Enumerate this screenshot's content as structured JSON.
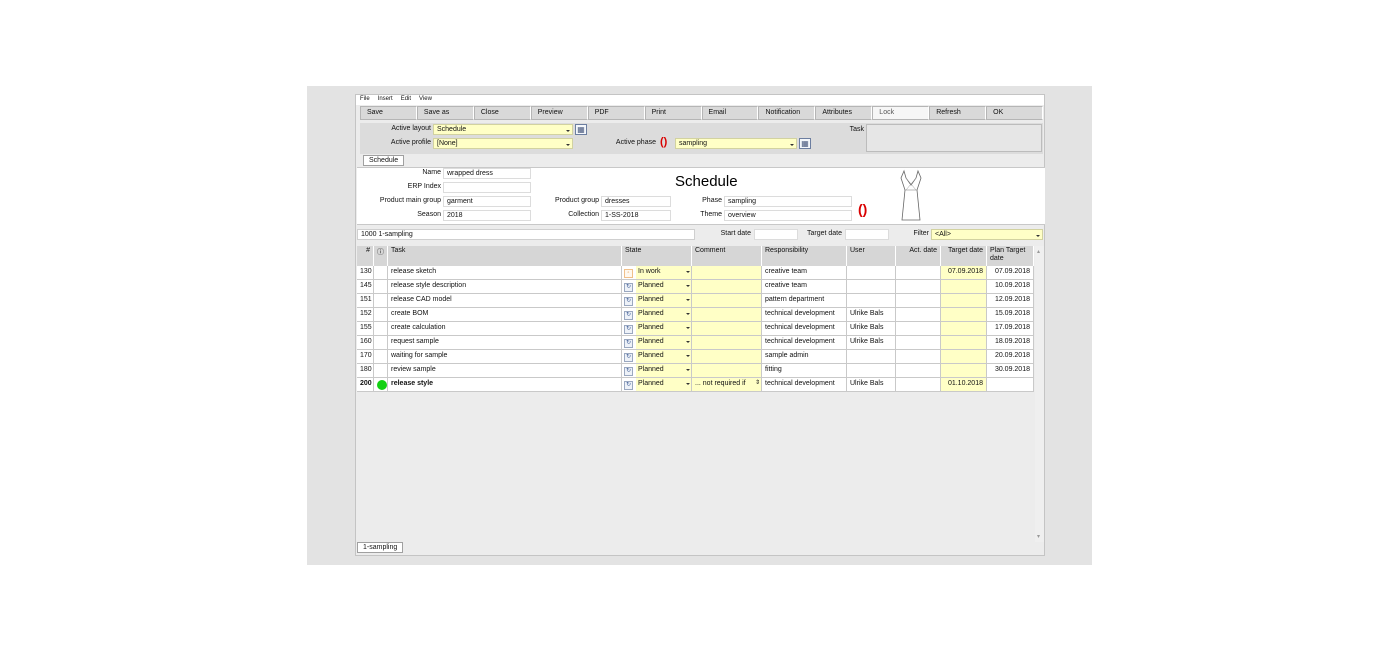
{
  "menu": [
    "File",
    "Insert",
    "Edit",
    "View"
  ],
  "toolbar": {
    "save": "Save",
    "save_as": "Save as",
    "close": "Close",
    "preview": "Preview",
    "pdf": "PDF",
    "print": "Print",
    "email": "Email",
    "notification": "Notification",
    "attributes": "Attributes",
    "lock": "Lock",
    "refresh": "Refresh",
    "ok": "OK"
  },
  "top": {
    "active_layout_label": "Active layout",
    "active_layout_value": "Schedule",
    "active_profile_label": "Active profile",
    "active_profile_value": "[None]",
    "active_phase_label": "Active phase",
    "active_phase_value": "sampling",
    "task_label": "Task"
  },
  "tab": "Schedule",
  "header": {
    "name_label": "Name",
    "name_value": "wrapped dress",
    "erp_label": "ERP Index",
    "erp_value": "",
    "pmg_label": "Product main group",
    "pmg_value": "garment",
    "season_label": "Season",
    "season_value": "2018",
    "pg_label": "Product group",
    "pg_value": "dresses",
    "collection_label": "Collection",
    "collection_value": "1-SS-2018",
    "title": "Schedule",
    "phase_label": "Phase",
    "phase_value": "sampling",
    "theme_label": "Theme",
    "theme_value": "overview"
  },
  "filterbar": {
    "phase_value": "1000 1-sampling",
    "start_label": "Start date",
    "target_label": "Target date",
    "filter_label": "Filter",
    "filter_value": "<All>"
  },
  "columns": {
    "num": "#",
    "info": "ⓘ",
    "task": "Task",
    "state": "State",
    "comment": "Comment",
    "responsibility": "Responsibility",
    "user": "User",
    "act_date": "Act. date",
    "target_date": "Target date",
    "plan_target": "Plan Target date"
  },
  "rows": [
    {
      "num": "130",
      "task": "release sketch",
      "state": "In work",
      "comment": "",
      "resp": "creative team",
      "user": "",
      "act": "",
      "target": "07.09.2018",
      "plan": "07.09.2018"
    },
    {
      "num": "145",
      "task": "release style description",
      "state": "Planned",
      "comment": "",
      "resp": "creative team",
      "user": "",
      "act": "",
      "target": "",
      "plan": "10.09.2018"
    },
    {
      "num": "151",
      "task": "release CAD model",
      "state": "Planned",
      "comment": "",
      "resp": "pattern department",
      "user": "",
      "act": "",
      "target": "",
      "plan": "12.09.2018"
    },
    {
      "num": "152",
      "task": "create BOM",
      "state": "Planned",
      "comment": "",
      "resp": "technical development",
      "user": "Ulrike Bals",
      "act": "",
      "target": "",
      "plan": "15.09.2018"
    },
    {
      "num": "155",
      "task": "create calculation",
      "state": "Planned",
      "comment": "",
      "resp": "technical development",
      "user": "Ulrike Bals",
      "act": "",
      "target": "",
      "plan": "17.09.2018"
    },
    {
      "num": "160",
      "task": "request sample",
      "state": "Planned",
      "comment": "",
      "resp": "technical development",
      "user": "Ulrike Bals",
      "act": "",
      "target": "",
      "plan": "18.09.2018"
    },
    {
      "num": "170",
      "task": "waiting for sample",
      "state": "Planned",
      "comment": "",
      "resp": "sample admin",
      "user": "",
      "act": "",
      "target": "",
      "plan": "20.09.2018"
    },
    {
      "num": "180",
      "task": "review sample",
      "state": "Planned",
      "comment": "",
      "resp": "fitting",
      "user": "",
      "act": "",
      "target": "",
      "plan": "30.09.2018"
    },
    {
      "num": "200",
      "task": "release style",
      "state": "Planned",
      "comment": "... not required if",
      "resp": "technical development",
      "user": "Ulrike Bals",
      "act": "",
      "target": "01.10.2018",
      "plan": ""
    }
  ],
  "bottom_tab": "1-sampling"
}
